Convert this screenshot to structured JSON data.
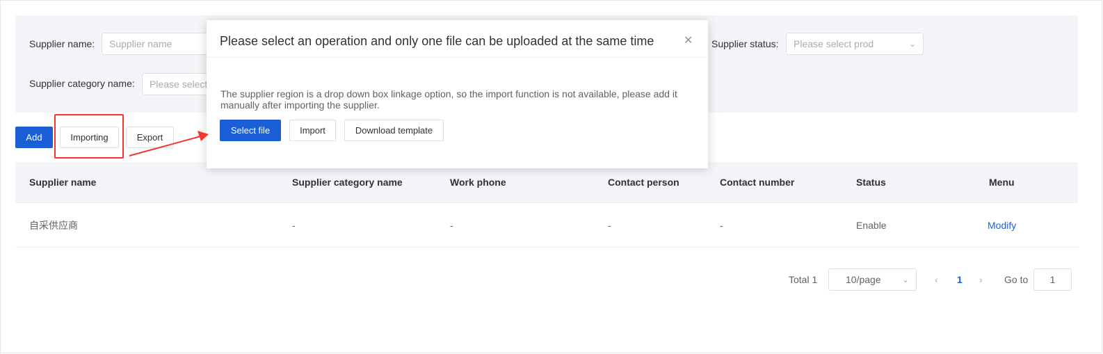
{
  "filter": {
    "supplier_name_label": "Supplier name:",
    "supplier_name_placeholder": "Supplier name",
    "supplier_status_label": "Supplier status:",
    "supplier_status_placeholder": "Please select prod",
    "category_label": "Supplier category name:",
    "category_placeholder": "Please select"
  },
  "toolbar": {
    "add": "Add",
    "importing": "Importing",
    "export": "Export"
  },
  "table": {
    "headers": [
      "Supplier name",
      "Supplier category name",
      "Work phone",
      "Contact person",
      "Contact number",
      "Status",
      "Menu"
    ],
    "rows": [
      [
        "自采供应商",
        "-",
        "-",
        "-",
        "-",
        "Enable",
        "Modify"
      ]
    ]
  },
  "pagination": {
    "total": "Total 1",
    "page_size": "10/page",
    "current_page": "1",
    "goto_label": "Go to",
    "goto_value": "1"
  },
  "dialog": {
    "title": "Please select an operation and only one file can be uploaded at the same time",
    "message": "The supplier region is a drop down box linkage option, so the import function is not available, please add it manually after importing the supplier.",
    "select_file": "Select file",
    "import": "Import",
    "download_template": "Download template"
  },
  "colors": {
    "primary": "#1a5fd6",
    "annotation": "#f5362f",
    "panel_bg": "#f4f5f8"
  }
}
